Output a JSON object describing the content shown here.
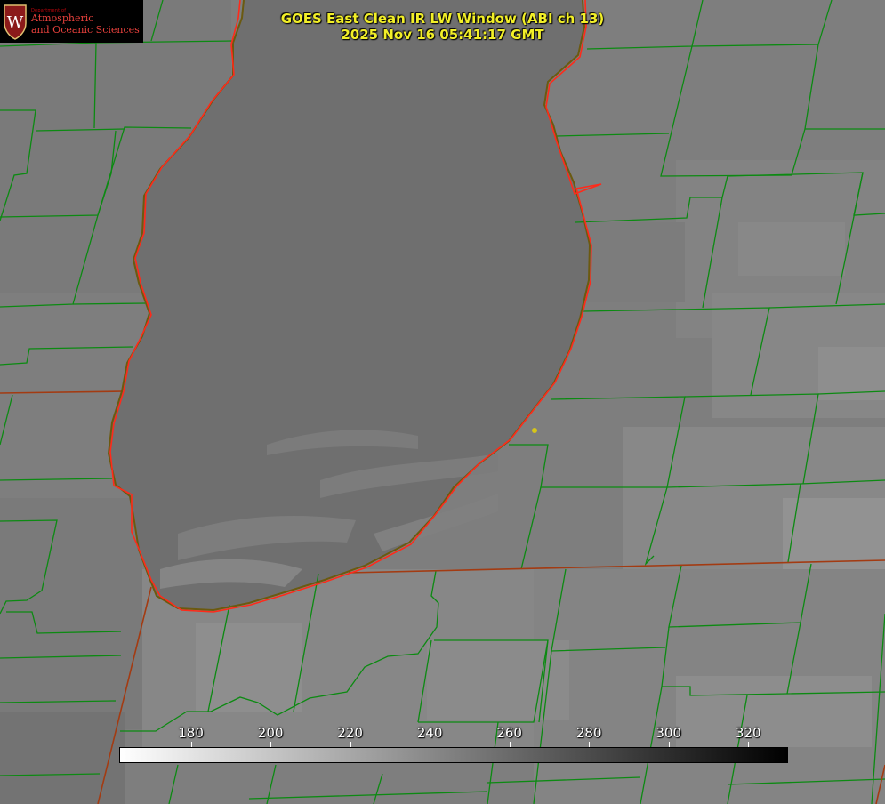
{
  "header": {
    "title_line1": "GOES East Clean IR LW Window (ABI ch 13)",
    "title_line2": "2025 Nov 16 05:41:17 GMT"
  },
  "logo": {
    "crest_letter": "W",
    "dept_text": "Department of",
    "line1": "Atmospheric",
    "line2": "and Oceanic Sciences"
  },
  "colorbar": {
    "tick_labels": [
      "180",
      "200",
      "220",
      "240",
      "260",
      "280",
      "300",
      "320"
    ],
    "ticks": [
      180,
      200,
      220,
      240,
      260,
      280,
      300,
      320
    ],
    "range": [
      162,
      330
    ],
    "gradient_start_color": "#ffffff",
    "gradient_end_color": "#000000"
  },
  "colors": {
    "title": "#f2ef28",
    "county_lines": "#0c8a12",
    "state_lines": "#a33b12",
    "coastline_hires": "#ff2a1a",
    "coastline_lowres": "#6b5a10",
    "lake_fill": "#6f6f6f",
    "land_fill": "#7f7f7f",
    "marker": "#d6c519"
  },
  "map": {
    "marker_icon": "station-dot-icon"
  }
}
